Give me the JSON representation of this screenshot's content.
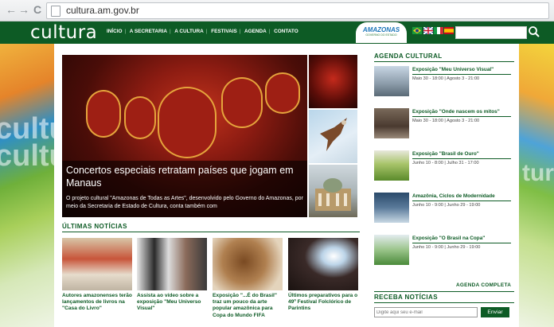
{
  "browser": {
    "url": "cultura.am.gov.br",
    "back_glyph": "←",
    "forward_glyph": "→",
    "reload_glyph": "C"
  },
  "header": {
    "logo": "cultura",
    "nav": [
      "INÍCIO",
      "A SECRETARIA",
      "A CULTURA",
      "FESTIVAIS",
      "AGENDA",
      "CONTATO"
    ],
    "gov_logo": "AMAZONAS",
    "gov_logo_sub": "GOVERNO DO ESTADO",
    "search_icon": "search-icon",
    "flags": [
      "brazil-flag",
      "uk-flag",
      "italy-flag",
      "spain-flag"
    ]
  },
  "decor": {
    "left_word": "cultura",
    "right_word": "tura"
  },
  "hero": {
    "title": "Concertos especiais retratam países que jogam em Manaus",
    "description": "O projeto cultural \"Amazonas de Todas as Artes\", desenvolvido pelo Governo do Amazonas, por meio da Secretaria de Estado de Cultura, conta também com"
  },
  "news": {
    "title": "ÚLTIMAS NOTÍCIAS",
    "items": [
      {
        "caption": "Autores amazonenses terão lançamentos de livros na \"Casa do Livro\"",
        "color": "#b8462e"
      },
      {
        "caption": "Assista ao vídeo sobre a exposição \"Meu Universo Visual\"",
        "color": "#8a8a8a"
      },
      {
        "caption": "Exposição \"...É do Brasil\" traz um pouco da arte popular amazônica para Copa do Mundo FIFA",
        "color": "#9a6a3a"
      },
      {
        "caption": "Últimos preparativos para o 49º Festival Folclórico de Parintins",
        "color": "#3a2a2a"
      }
    ]
  },
  "agenda": {
    "title": "AGENDA CULTURAL",
    "items": [
      {
        "title": "Exposição \"Meu Universo Visual\"",
        "dates": "Maio 30 - 18:00  |  Agosto 3 - 21:00",
        "color": "#9aa8b4"
      },
      {
        "title": "Exposição \"Onde nascem os mitos\"",
        "dates": "Maio 30 - 18:00  |  Agosto 3 - 21:00",
        "color": "#6a5a4a"
      },
      {
        "title": "Exposição \"Brasil de Ouro\"",
        "dates": "Junho 10 - 8:00  |  Julho 31 - 17:00",
        "color": "#7aa04a"
      },
      {
        "title": "Amazônia, Ciclos de Modernidade",
        "dates": "Junho 10 - 9:00  |  Junho 29 - 19:00",
        "color": "#3a5a7a"
      },
      {
        "title": "Exposição \"O Brasil na Copa\"",
        "dates": "Junho 10 - 9:00  |  Junho 29 - 19:00",
        "color": "#8ab87a"
      }
    ],
    "complete_link": "AGENDA COMPLETA"
  },
  "newsletter": {
    "title": "RECEBA NOTÍCIAS",
    "placeholder": "Digite aqui seu e-mail",
    "button": "Enviar"
  }
}
